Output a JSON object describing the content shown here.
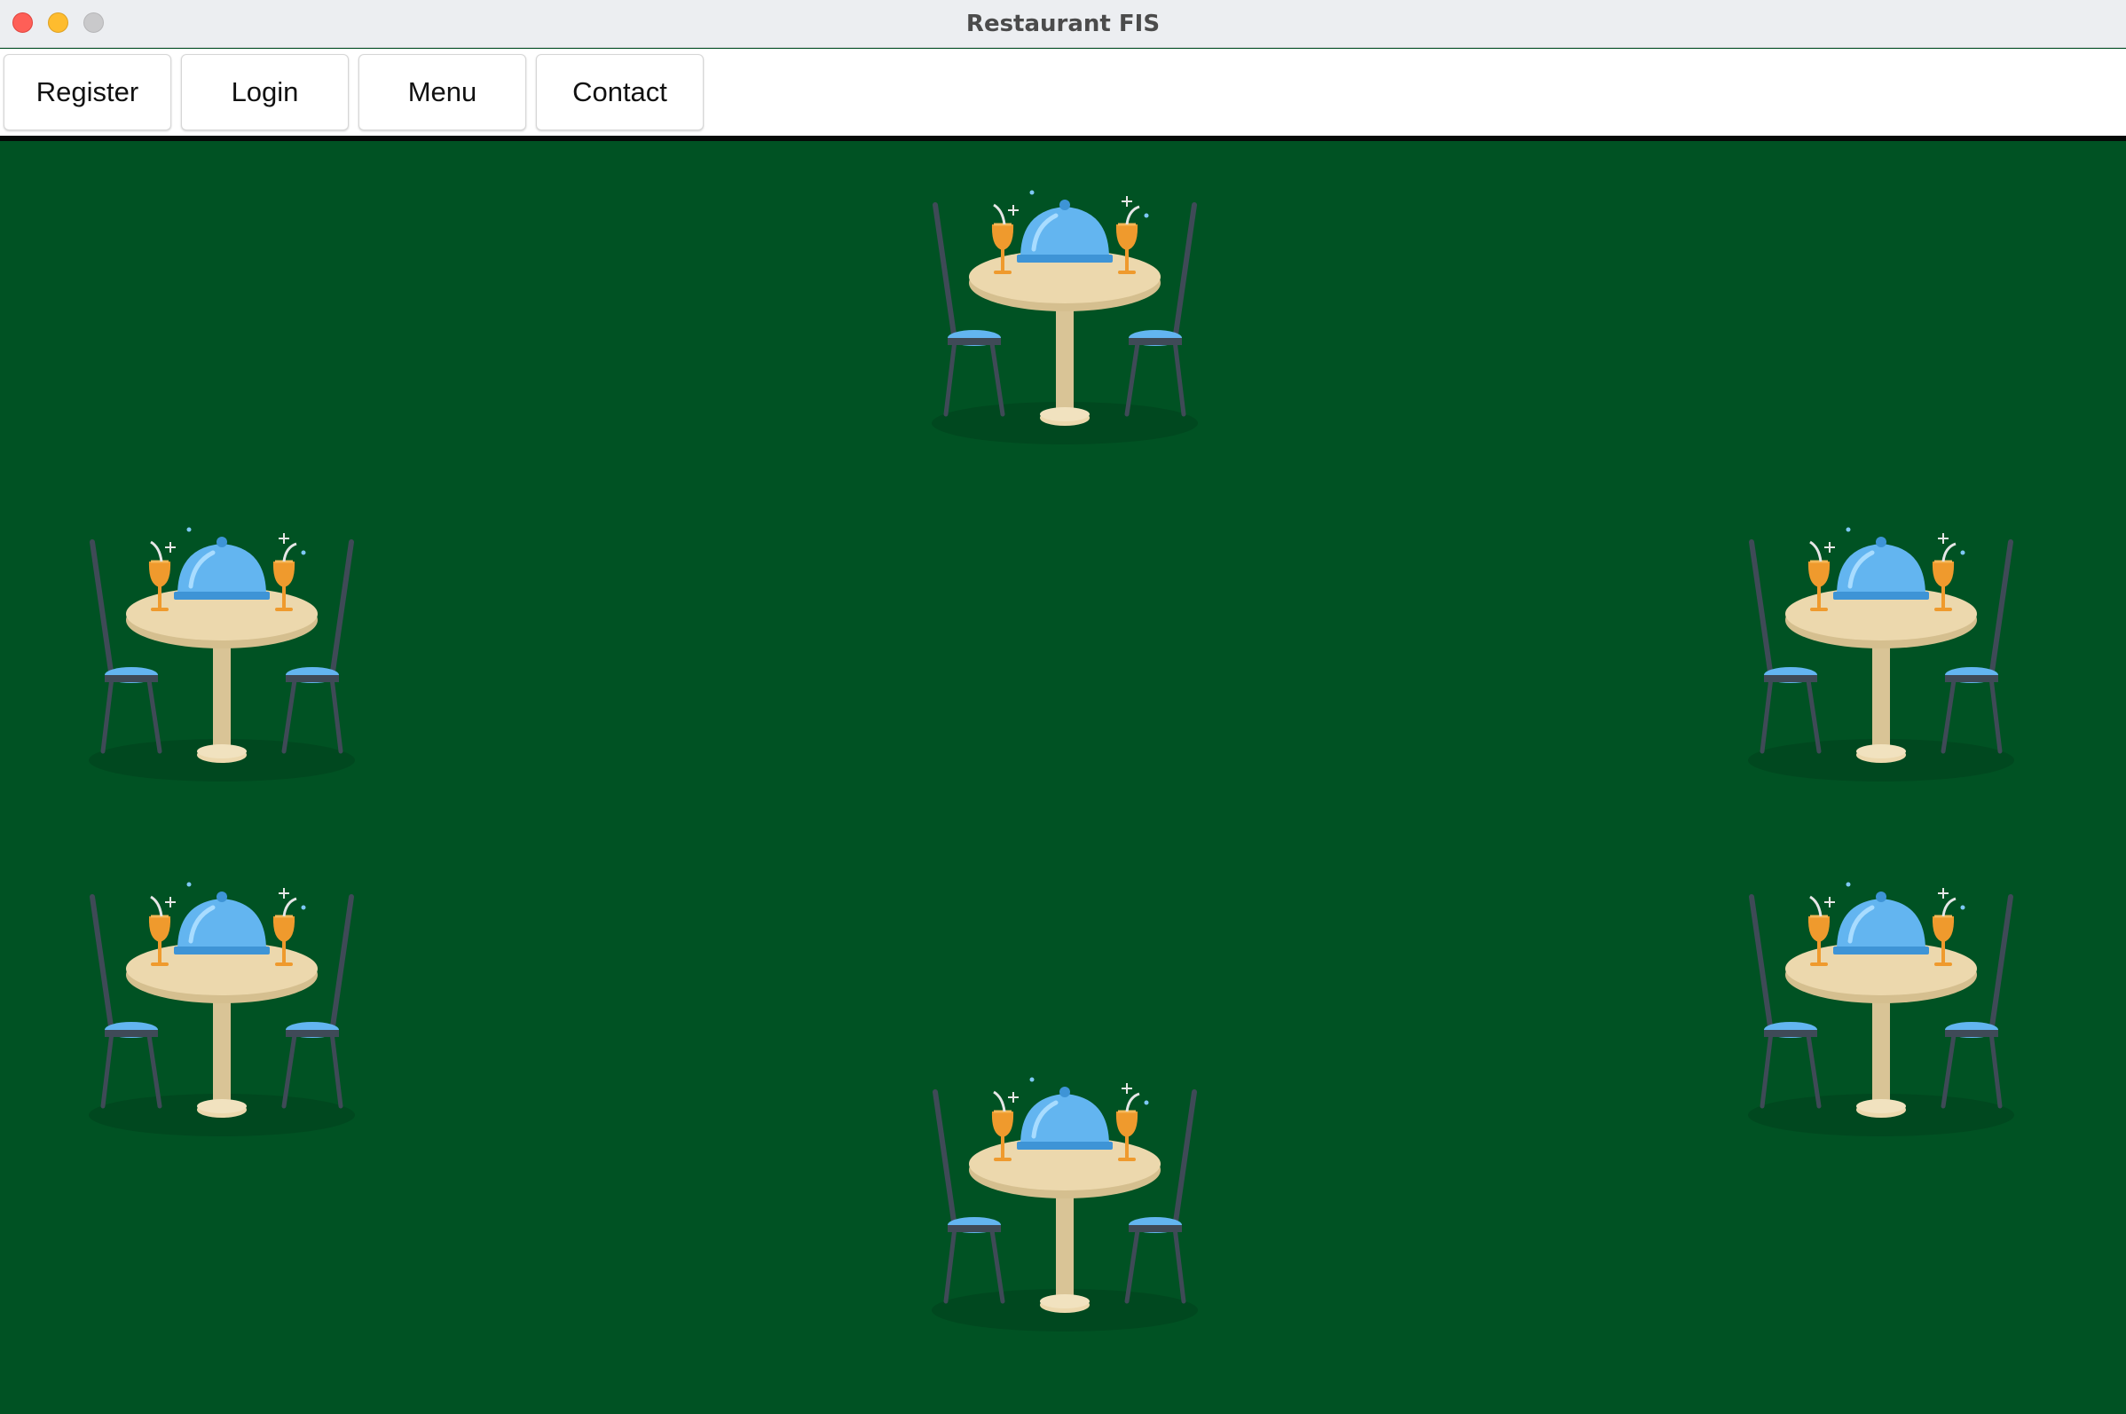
{
  "window": {
    "title": "Restaurant FIS"
  },
  "toolbar": {
    "buttons": [
      {
        "label": "Register"
      },
      {
        "label": "Login"
      },
      {
        "label": "Menu"
      },
      {
        "label": "Contact"
      }
    ]
  },
  "floor": {
    "background_color": "#005223",
    "table_count": 6
  },
  "colors": {
    "cloche": "#63b5f0",
    "table_top": "#ecd8ad",
    "chair_frame": "#3f4a57",
    "glass": "#ef9a2d"
  }
}
